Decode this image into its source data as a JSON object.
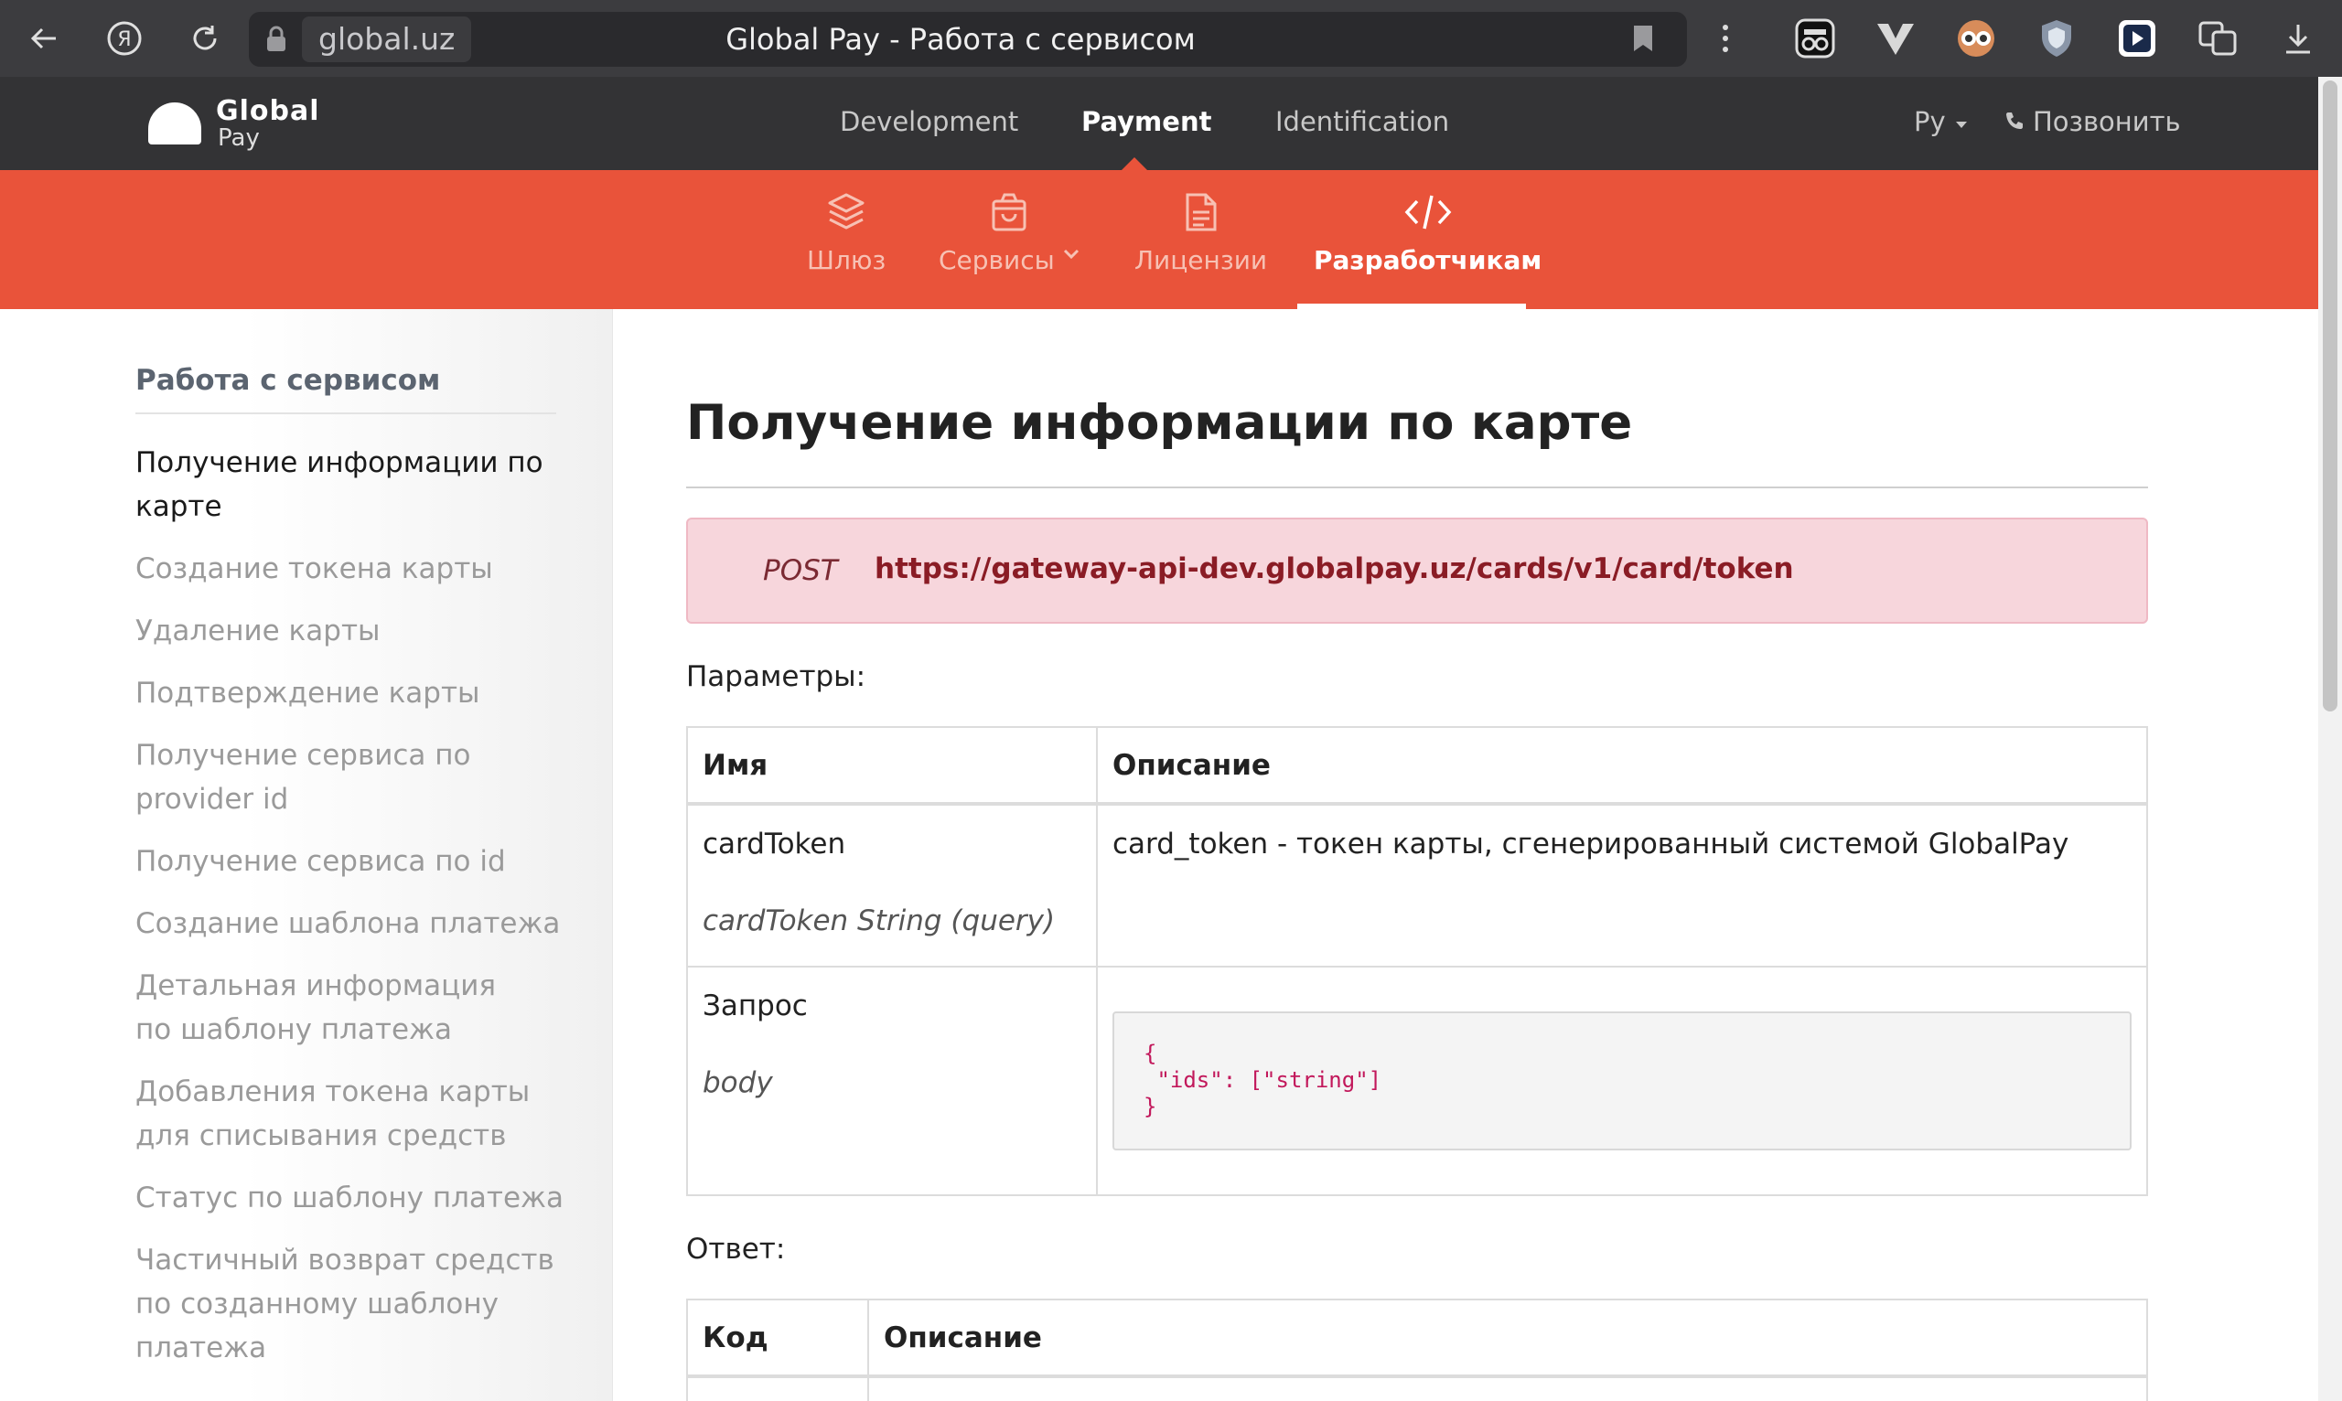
{
  "browser": {
    "domain": "global.uz",
    "page_title": "Global Pay - Работа с сервисом",
    "icons": [
      "back-arrow-icon",
      "yandex-icon",
      "reload-icon",
      "lock-icon",
      "bookmark-icon",
      "menu-dots-icon",
      "extension-incognito-icon",
      "extension-v-icon",
      "extension-owl-icon",
      "extension-shield-icon",
      "extension-play-icon",
      "extension-translate-icon",
      "download-icon"
    ]
  },
  "site": {
    "logo": {
      "line1": "Global",
      "line2": "Pay"
    },
    "topnav": [
      "Development",
      "Payment",
      "Identification"
    ],
    "topnav_active": "Payment",
    "lang": "Ру",
    "call": "Позвонить",
    "subnav": [
      {
        "label": "Шлюз",
        "icon": "layers-icon"
      },
      {
        "label": "Сервисы",
        "icon": "bag-icon"
      },
      {
        "label": "Лицензии",
        "icon": "document-icon"
      },
      {
        "label": "Разработчикам",
        "icon": "code-icon"
      }
    ],
    "colors": {
      "accent": "#e9533a",
      "header": "#333335"
    }
  },
  "sidebar": {
    "title": "Работа с сервисом",
    "items": [
      "Получение информации по карте",
      "Создание токена карты",
      "Удаление карты",
      "Подтверждение карты",
      "Получение сервиса по provider id",
      "Получение сервиса по id",
      "Создание шаблона платежа",
      "Детальная информация по шаблону платежа",
      "Добавления токена карты для списывания средств",
      "Статус по шаблону платежа",
      "Частичный возврат средств по созданному шаблону платежа"
    ]
  },
  "main": {
    "title": "Получение информации по карте",
    "method": "POST",
    "url": "https://gateway-api-dev.globalpay.uz/cards/v1/card/token",
    "params_label": "Параметры:",
    "params_table": {
      "headers": [
        "Имя",
        "Описание"
      ],
      "rows": [
        {
          "name": "cardToken",
          "type": "cardToken String (query)",
          "description": "card_token - токен карты, сгенерированный системой GlobalPay"
        },
        {
          "name": "Запрос",
          "type": "body",
          "code": "{\n \"ids\": [\"string\"]\n}"
        }
      ]
    },
    "response_label": "Ответ:",
    "response_table": {
      "headers": [
        "Код",
        "Описание"
      ]
    }
  }
}
